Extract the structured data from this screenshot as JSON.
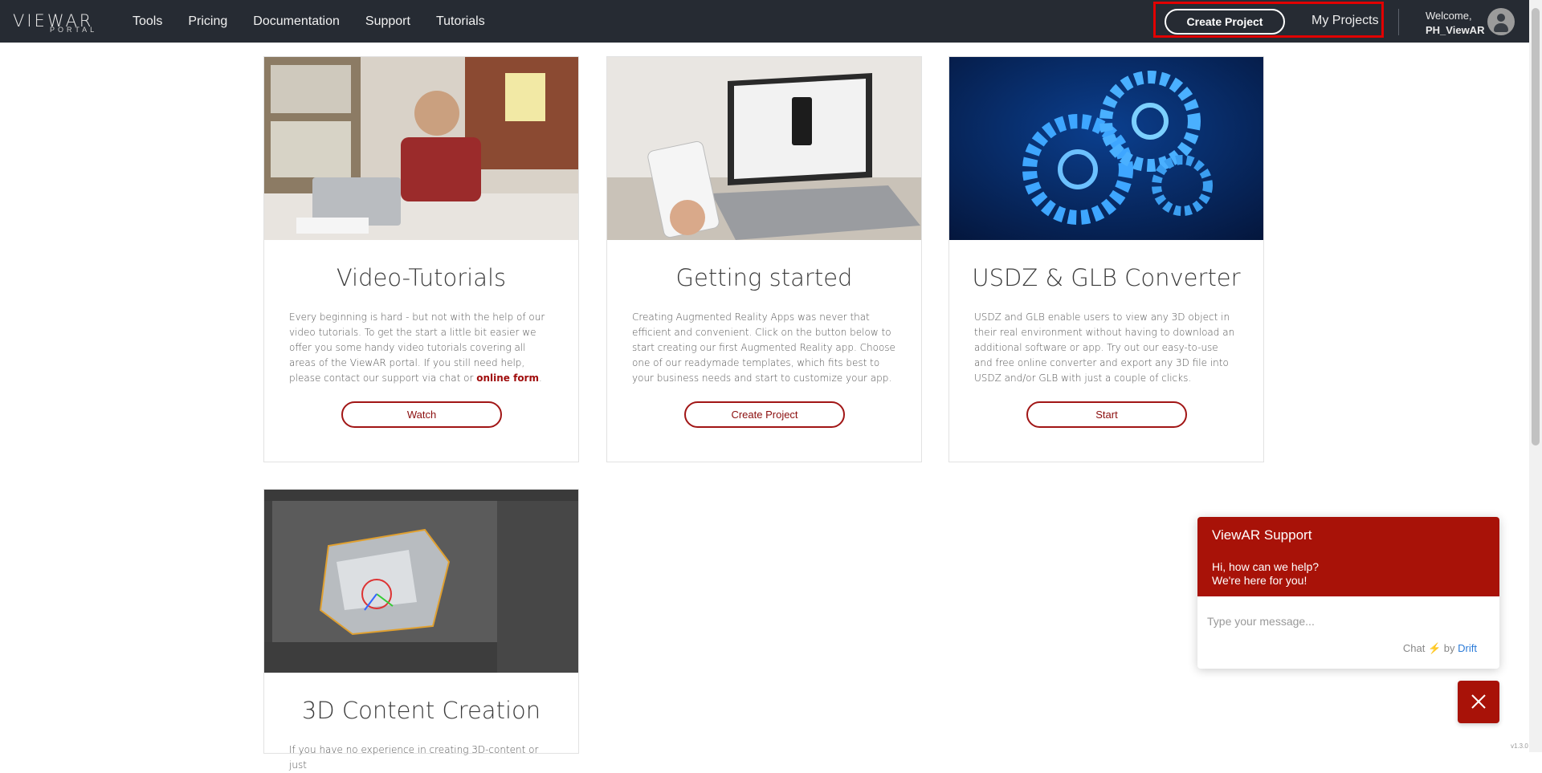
{
  "header": {
    "logo_main": "VIEWAR",
    "logo_sub": "PORTAL",
    "nav": [
      "Tools",
      "Pricing",
      "Documentation",
      "Support",
      "Tutorials"
    ],
    "create_project": "Create Project",
    "my_projects": "My Projects",
    "welcome": "Welcome,",
    "username": "PH_ViewAR"
  },
  "cards": [
    {
      "title": "Video-Tutorials",
      "text": "Every beginning is hard - but not with the help of our video tutorials. To get the start a little bit easier we offer you some handy video tutorials covering all areas of the ViewAR portal. If you still need help, please contact our support via chat or ",
      "link": "online form",
      "text_end": ".",
      "button": "Watch"
    },
    {
      "title": "Getting started",
      "text": "Creating Augmented Reality Apps was never that efficient and convenient. Click on the button below to start creating our first Augmented Reality app. Choose one of our readymade templates, which fits best to your business needs and start to customize your app.",
      "button": "Create Project"
    },
    {
      "title": "USDZ & GLB Converter",
      "text": "USDZ and GLB enable users to view any 3D object in their real environment without having to download an additional software or app. Try out our easy-to-use and free online converter and export any 3D file into USDZ and/or GLB with just a couple of clicks.",
      "button": "Start"
    },
    {
      "title": "3D Content Creation",
      "text": "If you have no experience in creating 3D-content or just"
    }
  ],
  "chat": {
    "title": "ViewAR Support",
    "message_line1": "Hi, how can we help?",
    "message_line2": "We're here for you!",
    "placeholder": "Type your message...",
    "brand_prefix": "Chat",
    "brand_by": "by",
    "brand_name": "Drift"
  },
  "version": "v1.3.0",
  "colors": {
    "header_bg": "#262b33",
    "accent": "#a81208",
    "highlight_box": "#e10000"
  }
}
